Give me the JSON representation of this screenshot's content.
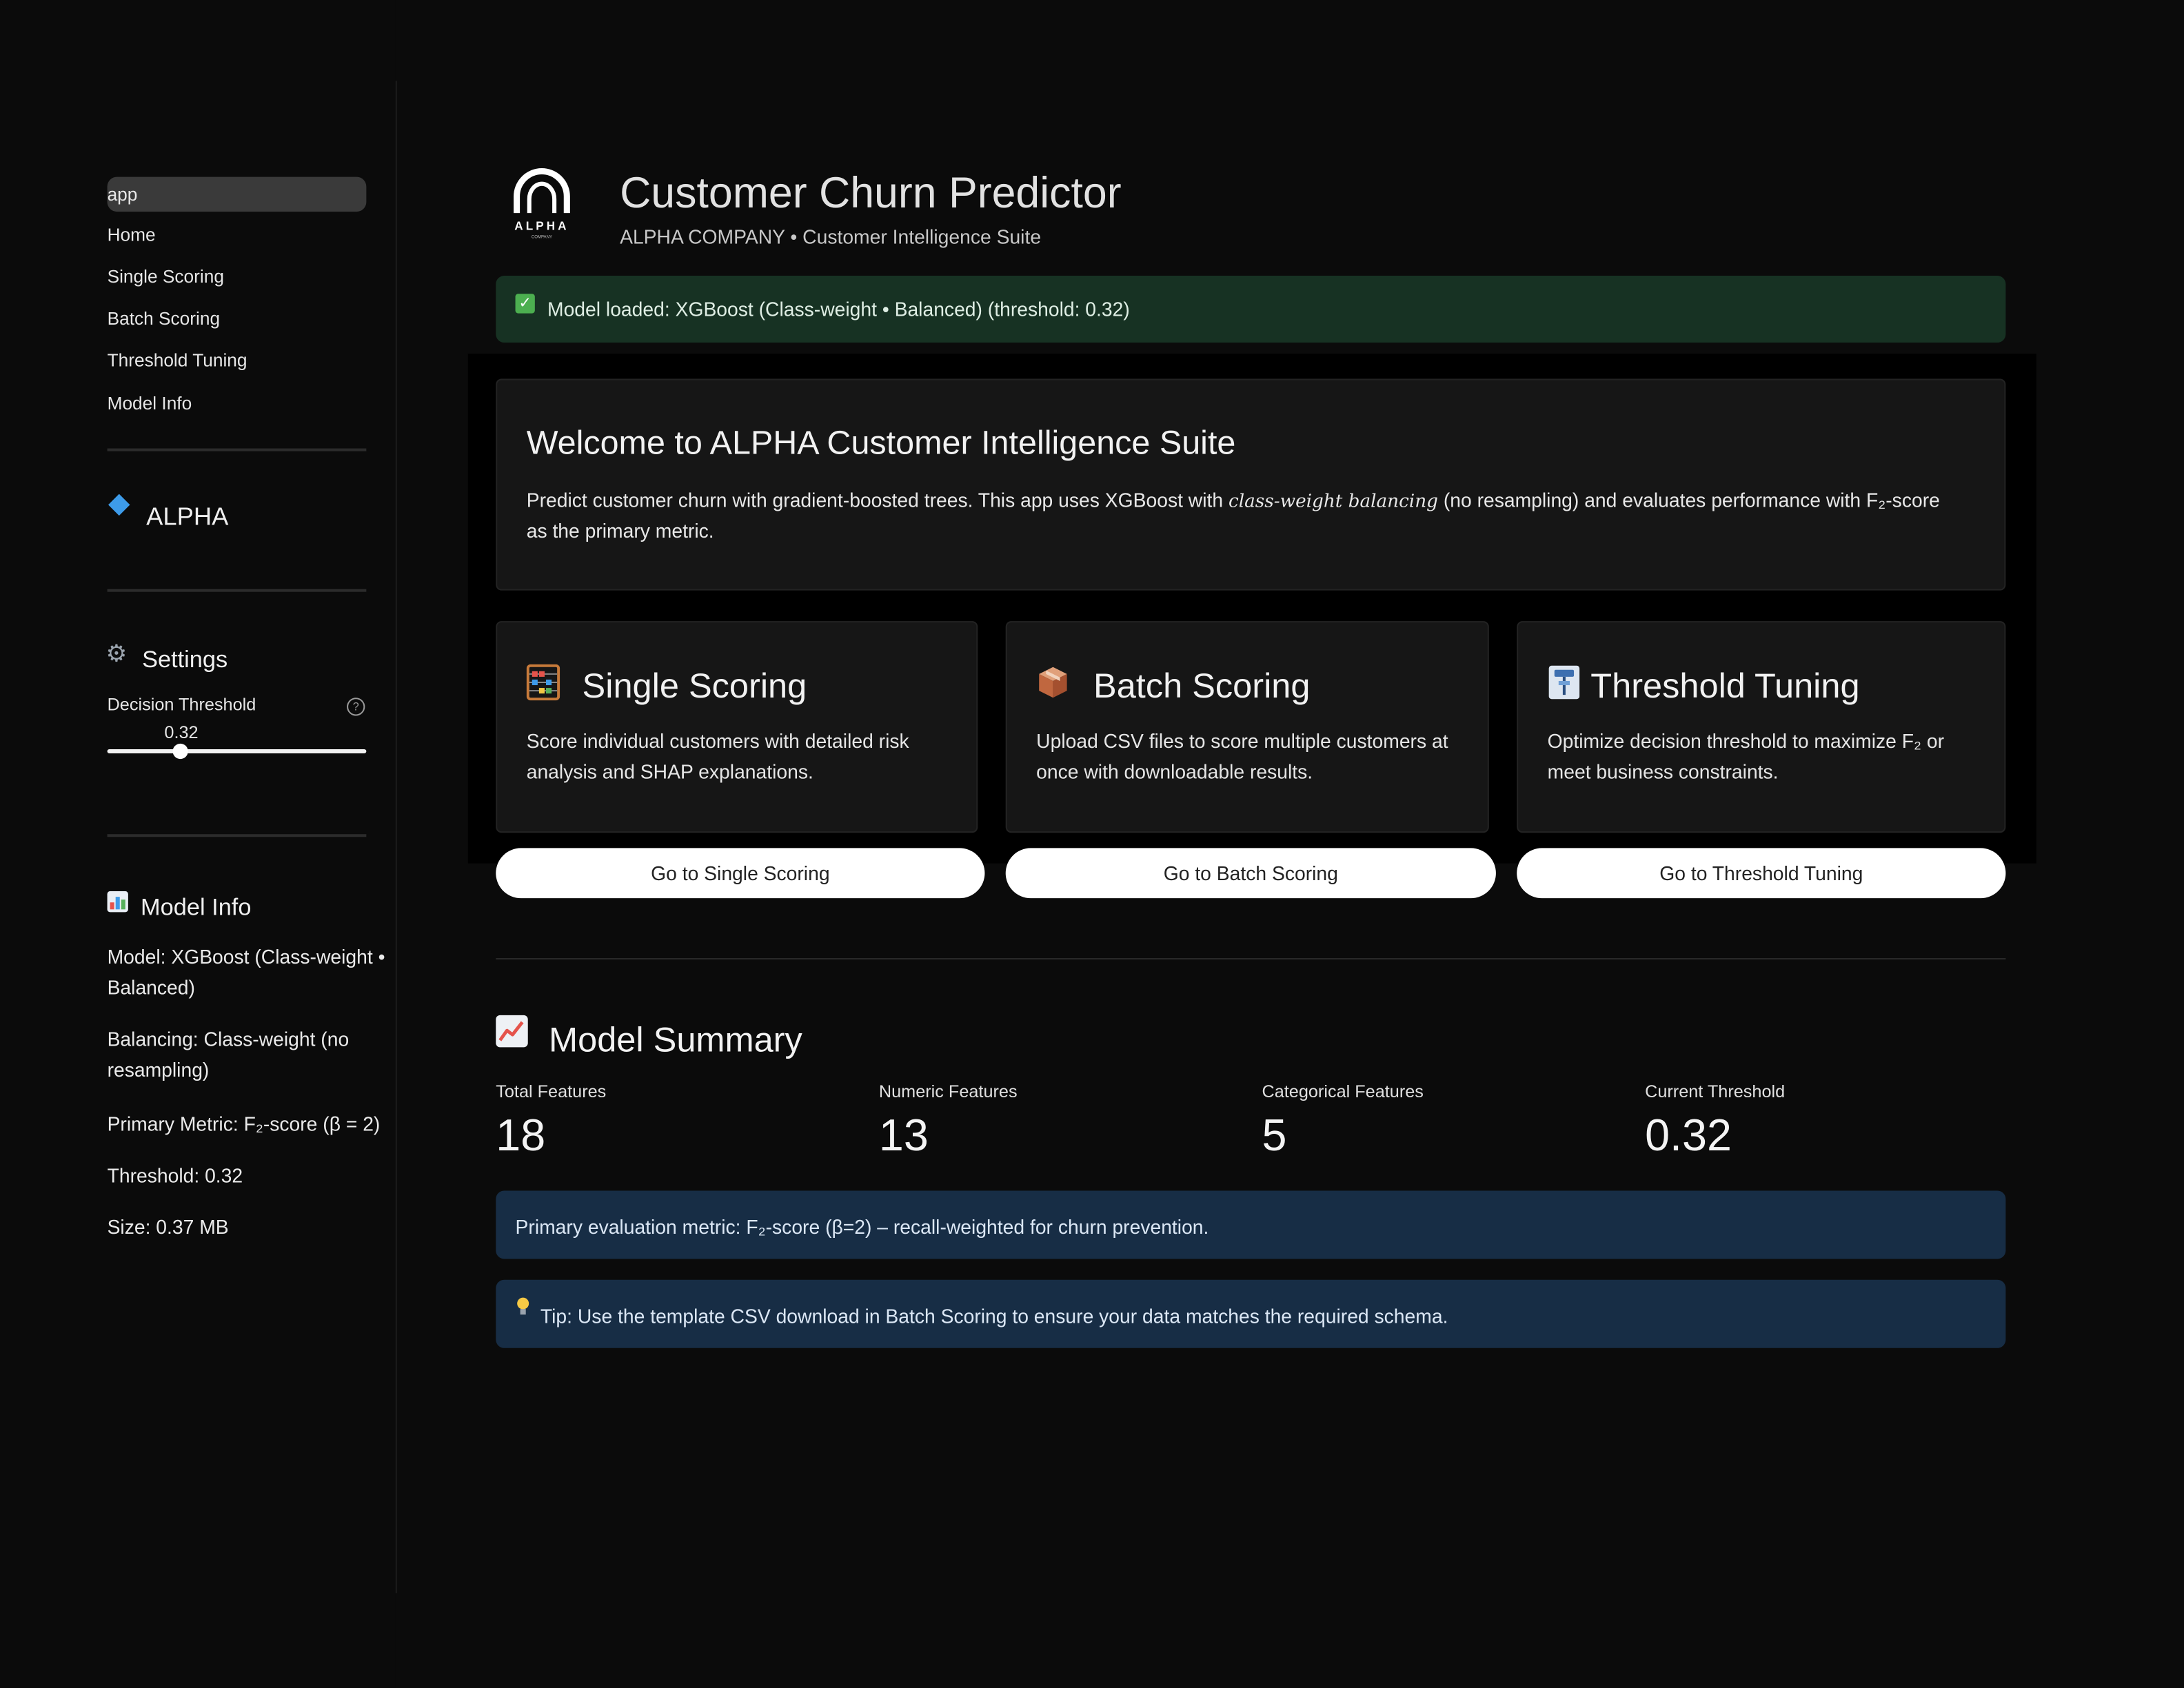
{
  "sidebar": {
    "current_page": "app",
    "nav_items": [
      "Home",
      "Single Scoring",
      "Batch Scoring",
      "Threshold Tuning",
      "Model Info"
    ],
    "brand": "ALPHA",
    "settings_heading": "Settings",
    "threshold_label": "Decision Threshold",
    "threshold_value": "0.32",
    "threshold_fraction": 0.28,
    "model_info_heading": "Model Info",
    "model_info": [
      "Model: XGBoost (Class-weight • Balanced)",
      "Balancing: Class-weight (no resampling)",
      "Primary Metric: F₂-score (β = 2)",
      "Threshold: 0.32",
      "Size: 0.37 MB"
    ]
  },
  "header": {
    "logo_text": "ALPHA",
    "logo_subtext": "COMPANY",
    "title": "Customer Churn Predictor",
    "subtitle": "ALPHA COMPANY • Customer Intelligence Suite"
  },
  "status_alert": "Model loaded: XGBoost (Class-weight • Balanced) (threshold: 0.32)",
  "welcome": {
    "title": "Welcome to ALPHA Customer Intelligence Suite",
    "body_before": "Predict customer churn with gradient-boosted trees. This app uses XGBoost with ",
    "body_emphasis": "class-weight balancing",
    "body_after": " (no resampling) and evaluates performance with F₂-score as the primary metric."
  },
  "features": [
    {
      "title": "Single Scoring",
      "desc": "Score individual customers with detailed risk analysis and SHAP explanations.",
      "button": "Go to Single Scoring",
      "icon": "abacus-icon"
    },
    {
      "title": "Batch Scoring",
      "desc": "Upload CSV files to score multiple customers at once with downloadable results.",
      "button": "Go to Batch Scoring",
      "icon": "package-icon"
    },
    {
      "title": "Threshold Tuning",
      "desc": "Optimize decision threshold to maximize F₂ or meet business constraints.",
      "button": "Go to Threshold Tuning",
      "icon": "pushpin-icon"
    }
  ],
  "summary": {
    "title": "Model Summary",
    "metrics": [
      {
        "label": "Total Features",
        "value": "18"
      },
      {
        "label": "Numeric Features",
        "value": "13"
      },
      {
        "label": "Categorical Features",
        "value": "5"
      },
      {
        "label": "Current Threshold",
        "value": "0.32"
      }
    ],
    "info": "Primary evaluation metric: F₂-score (β=2) – recall-weighted for churn prevention.",
    "tip": "Tip: Use the template CSV download in Batch Scoring to ensure your data matches the required schema."
  },
  "colors": {
    "background": "#0b0b0b",
    "success_bg": "#173223",
    "info_bg": "#172d45",
    "accent": "#3d9be9"
  }
}
